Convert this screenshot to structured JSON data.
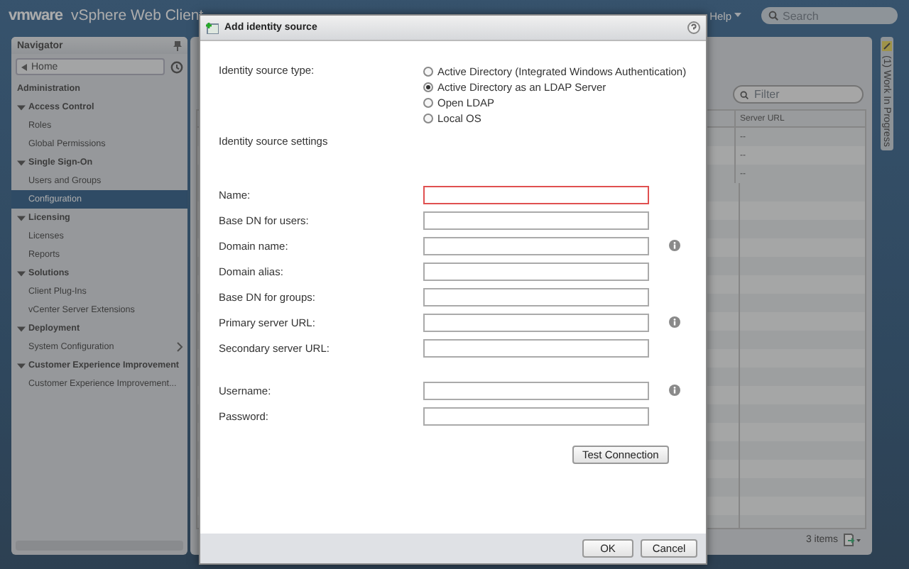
{
  "header": {
    "logo": "vmware",
    "product": "vSphere Web Client",
    "help": "Help",
    "search": {
      "placeholder": "Search"
    }
  },
  "navigator": {
    "title": "Navigator",
    "home": "Home",
    "tree": [
      {
        "label": "Administration",
        "kind": "heading"
      },
      {
        "label": "Access Control",
        "kind": "group",
        "expanded": true,
        "children": [
          {
            "label": "Roles",
            "selected": false,
            "drill": false
          },
          {
            "label": "Global Permissions",
            "selected": false,
            "drill": false
          }
        ]
      },
      {
        "label": "Single Sign-On",
        "kind": "group",
        "expanded": true,
        "children": [
          {
            "label": "Users and Groups",
            "selected": false,
            "drill": false
          },
          {
            "label": "Configuration",
            "selected": true,
            "drill": false
          }
        ]
      },
      {
        "label": "Licensing",
        "kind": "group",
        "expanded": true,
        "children": [
          {
            "label": "Licenses",
            "selected": false,
            "drill": false
          },
          {
            "label": "Reports",
            "selected": false,
            "drill": false
          }
        ]
      },
      {
        "label": "Solutions",
        "kind": "group",
        "expanded": true,
        "children": [
          {
            "label": "Client Plug-Ins",
            "selected": false,
            "drill": false
          },
          {
            "label": "vCenter Server Extensions",
            "selected": false,
            "drill": false
          }
        ]
      },
      {
        "label": "Deployment",
        "kind": "group",
        "expanded": true,
        "children": [
          {
            "label": "System Configuration",
            "selected": false,
            "drill": true
          }
        ]
      },
      {
        "label": "Customer Experience Improvement",
        "kind": "group",
        "expanded": true,
        "children": [
          {
            "label": "Customer Experience Improvement...",
            "selected": false,
            "drill": false
          }
        ]
      }
    ]
  },
  "main": {
    "filter": {
      "placeholder": "Filter"
    },
    "table": {
      "columns": [
        "Server URL"
      ],
      "rows": [
        [
          "--"
        ],
        [
          "--"
        ],
        [
          "--"
        ]
      ]
    },
    "footer": "3 items"
  },
  "side_panel": {
    "title": "(1) Work In Progress"
  },
  "dialog": {
    "title": "Add identity source",
    "type_label": "Identity source type:",
    "types": [
      {
        "label": "Active Directory (Integrated Windows Authentication)",
        "selected": false
      },
      {
        "label": "Active Directory as an LDAP Server",
        "selected": true
      },
      {
        "label": "Open LDAP",
        "selected": false
      },
      {
        "label": "Local OS",
        "selected": false
      }
    ],
    "settings_label": "Identity source settings",
    "field_groups": [
      {
        "fields": [
          {
            "label": "Name:",
            "error": true,
            "info": false
          },
          {
            "label": "Base DN for users:",
            "error": false,
            "info": false
          },
          {
            "label": "Domain name:",
            "error": false,
            "info": true
          },
          {
            "label": "Domain alias:",
            "error": false,
            "info": false
          },
          {
            "label": "Base DN for groups:",
            "error": false,
            "info": false
          },
          {
            "label": "Primary server URL:",
            "error": false,
            "info": true
          },
          {
            "label": "Secondary server URL:",
            "error": false,
            "info": false
          }
        ]
      },
      {
        "fields": [
          {
            "label": "Username:",
            "error": false,
            "info": true
          },
          {
            "label": "Password:",
            "error": false,
            "info": false
          }
        ]
      }
    ],
    "test_button": "Test Connection",
    "buttons": [
      "OK",
      "Cancel"
    ]
  }
}
